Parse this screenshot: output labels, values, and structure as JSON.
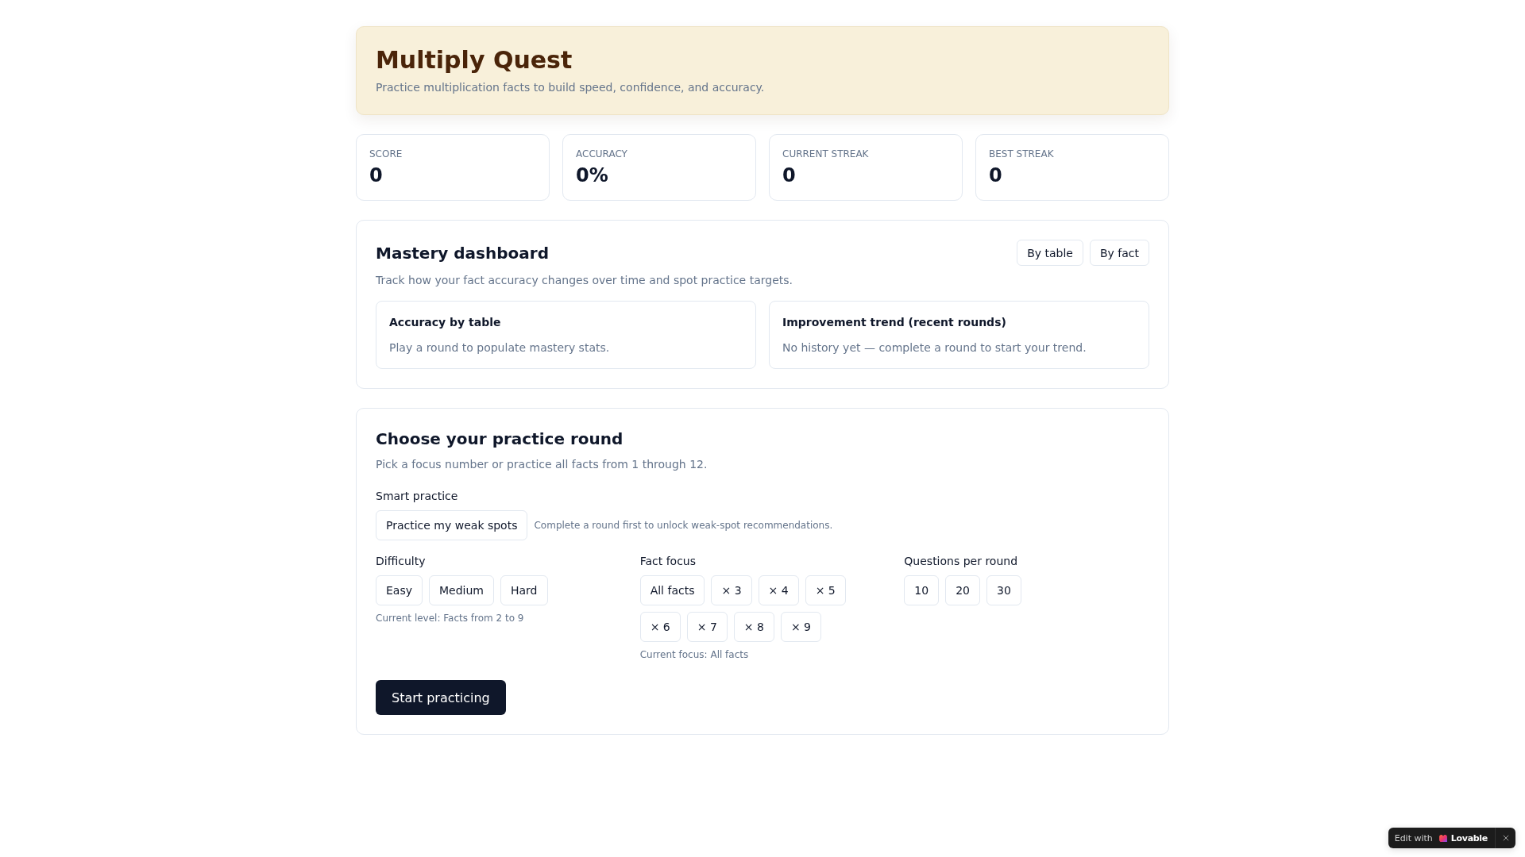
{
  "header": {
    "title": "Multiply Quest",
    "subtitle": "Practice multiplication facts to build speed, confidence, and accuracy."
  },
  "stats": [
    {
      "label": "SCORE",
      "value": "0"
    },
    {
      "label": "ACCURACY",
      "value": "0%"
    },
    {
      "label": "CURRENT STREAK",
      "value": "0"
    },
    {
      "label": "BEST STREAK",
      "value": "0"
    }
  ],
  "mastery": {
    "title": "Mastery dashboard",
    "subtitle": "Track how your fact accuracy changes over time and spot practice targets.",
    "views": [
      {
        "label": "By table",
        "selected": false
      },
      {
        "label": "By fact",
        "selected": false
      }
    ],
    "panels": [
      {
        "title": "Accuracy by table",
        "message": "Play a round to populate mastery stats."
      },
      {
        "title": "Improvement trend (recent rounds)",
        "message": "No history yet — complete a round to start your trend."
      }
    ]
  },
  "practice": {
    "title": "Choose your practice round",
    "subtitle": "Pick a focus number or practice all facts from 1 through 12.",
    "smart": {
      "label": "Smart practice",
      "button": "Practice my weak spots",
      "hint": "Complete a round first to unlock weak-spot recommendations."
    },
    "groups": [
      {
        "label": "Difficulty",
        "options": [
          {
            "label": "Easy",
            "selected": false
          },
          {
            "label": "Medium",
            "selected": false
          },
          {
            "label": "Hard",
            "selected": false
          }
        ],
        "note": "Current level: Facts from 2 to 9"
      },
      {
        "label": "Fact focus",
        "options": [
          {
            "label": "All facts",
            "selected": false
          },
          {
            "label": "× 3",
            "selected": false
          },
          {
            "label": "× 4",
            "selected": false
          },
          {
            "label": "× 5",
            "selected": false
          },
          {
            "label": "× 6",
            "selected": false
          },
          {
            "label": "× 7",
            "selected": false
          },
          {
            "label": "× 8",
            "selected": false
          },
          {
            "label": "× 9",
            "selected": false
          }
        ],
        "note": "Current focus: All facts"
      },
      {
        "label": "Questions per round",
        "options": [
          {
            "label": "10",
            "selected": false
          },
          {
            "label": "20",
            "selected": false
          },
          {
            "label": "30",
            "selected": false
          }
        ]
      }
    ],
    "start_button": "Start practicing"
  },
  "badge": {
    "text": "Edit with",
    "brand": "Lovable"
  }
}
